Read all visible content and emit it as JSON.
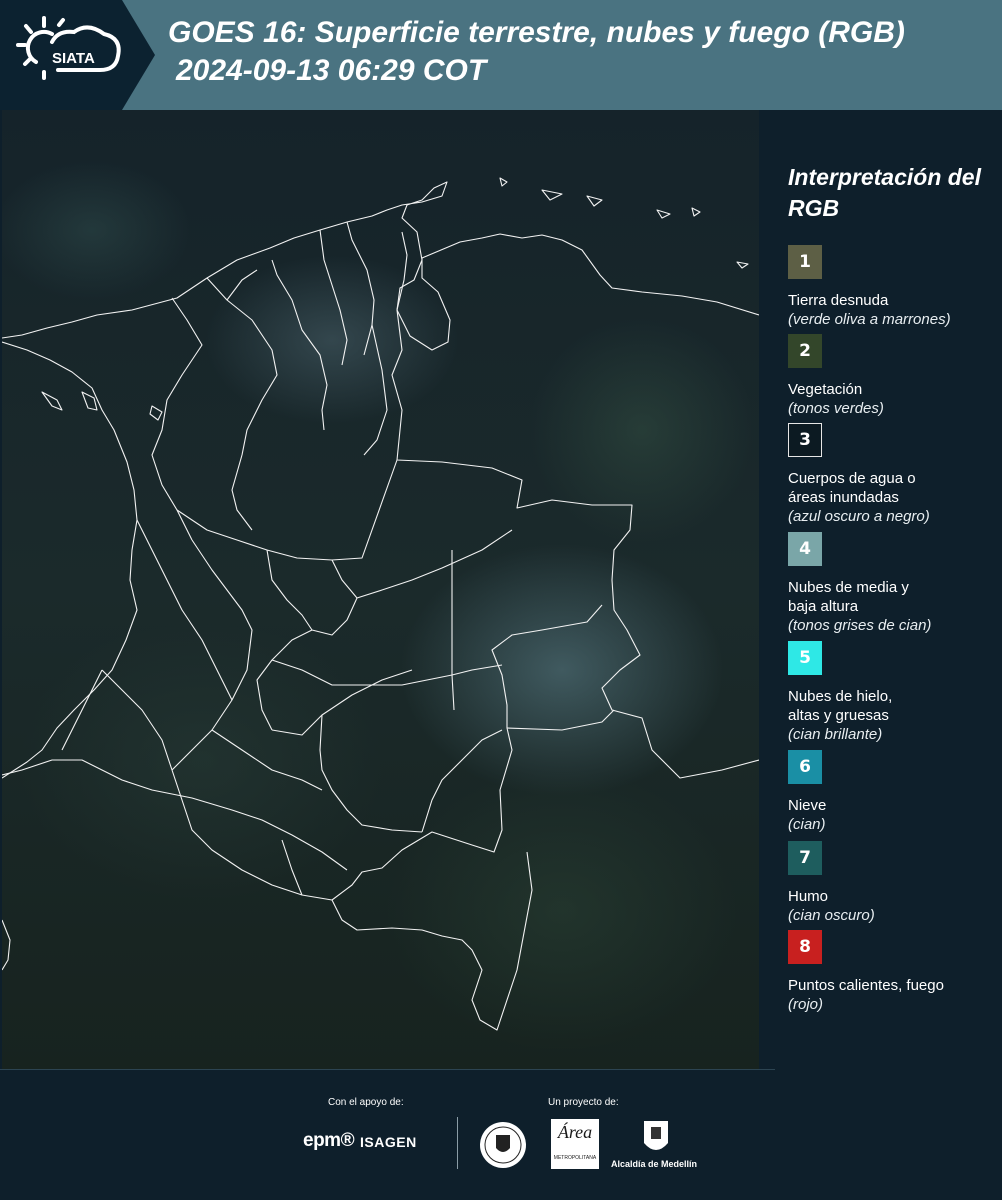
{
  "header": {
    "logo_text": "SIATA",
    "title_line1": "GOES 16: Superficie terrestre, nubes y fuego (RGB)",
    "title_line2": "2024-09-13 06:29 COT"
  },
  "legend": {
    "title": "Interpretación del RGB",
    "items": [
      {
        "number": "1",
        "label": "Tierra desnuda",
        "sub": "(verde oliva a marrones)",
        "color": "#5d5f45"
      },
      {
        "number": "2",
        "label": "Vegetación",
        "sub": "(tonos verdes)",
        "color": "#33462a"
      },
      {
        "number": "3",
        "label": "Cuerpos de agua o\náreas inundadas",
        "sub": "(azul oscuro a negro)",
        "color": "#0c1a22"
      },
      {
        "number": "4",
        "label": "Nubes de media y\nbaja altura",
        "sub": "(tonos grises de cian)",
        "color": "#7aa6a8"
      },
      {
        "number": "5",
        "label": "Nubes de hielo,\naltas y gruesas",
        "sub": "(cian brillante)",
        "color": "#2ee8e6"
      },
      {
        "number": "6",
        "label": "Nieve",
        "sub": "(cian)",
        "color": "#1a8fa5"
      },
      {
        "number": "7",
        "label": "Humo",
        "sub": "(cian oscuro)",
        "color": "#1e5d5e"
      },
      {
        "number": "8",
        "label": "Puntos calientes, fuego",
        "sub": "(rojo)",
        "color": "#c8201f"
      }
    ]
  },
  "footer": {
    "support_label": "Con el apoyo de:",
    "project_label": "Un proyecto de:",
    "epm": "epm®",
    "isagen": "ISAGEN",
    "area_word": "Área",
    "area_sub": "METROPOLITANA",
    "alcaldia": "Alcaldía de Medellín"
  }
}
